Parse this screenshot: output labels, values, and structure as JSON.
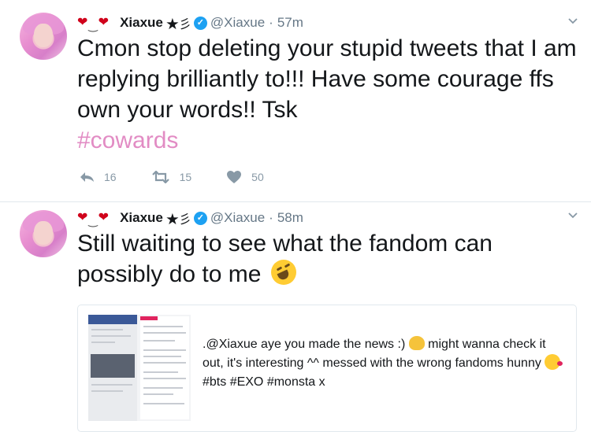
{
  "tweets": [
    {
      "hearts": "❤",
      "name": "Xiaxue",
      "name_suffix": "★彡",
      "handle": "@Xiaxue",
      "time": "57m",
      "text_before": "Cmon stop deleting your stupid tweets that I am replying brilliantly to!!! Have some courage ffs own your words!! Tsk",
      "hashtag": "#cowards",
      "reply_count": "16",
      "retweet_count": "15",
      "like_count": "50"
    },
    {
      "hearts": "❤",
      "name": "Xiaxue",
      "name_suffix": "★彡",
      "handle": "@Xiaxue",
      "time": "58m",
      "text_before": "Still waiting to see what the fandom can possibly do to me",
      "card": {
        "line1a": ".@Xiaxue aye you made the news :)",
        "line1b": "might wanna check it out, it's interesting ^^ messed with the wrong fandoms hunny",
        "line2": "#bts #EXO #monsta  x"
      }
    }
  ],
  "colors": {
    "heart": "#d0021b",
    "hashtag": "#e28cc4",
    "muted": "#8899a6",
    "verified": "#1da1f2"
  },
  "icons": [
    "reply-icon",
    "retweet-icon",
    "like-icon",
    "caret-down-icon",
    "verified-badge-icon",
    "rofl-emoji-icon",
    "clap-emoji-icon",
    "kiss-emoji-icon"
  ]
}
